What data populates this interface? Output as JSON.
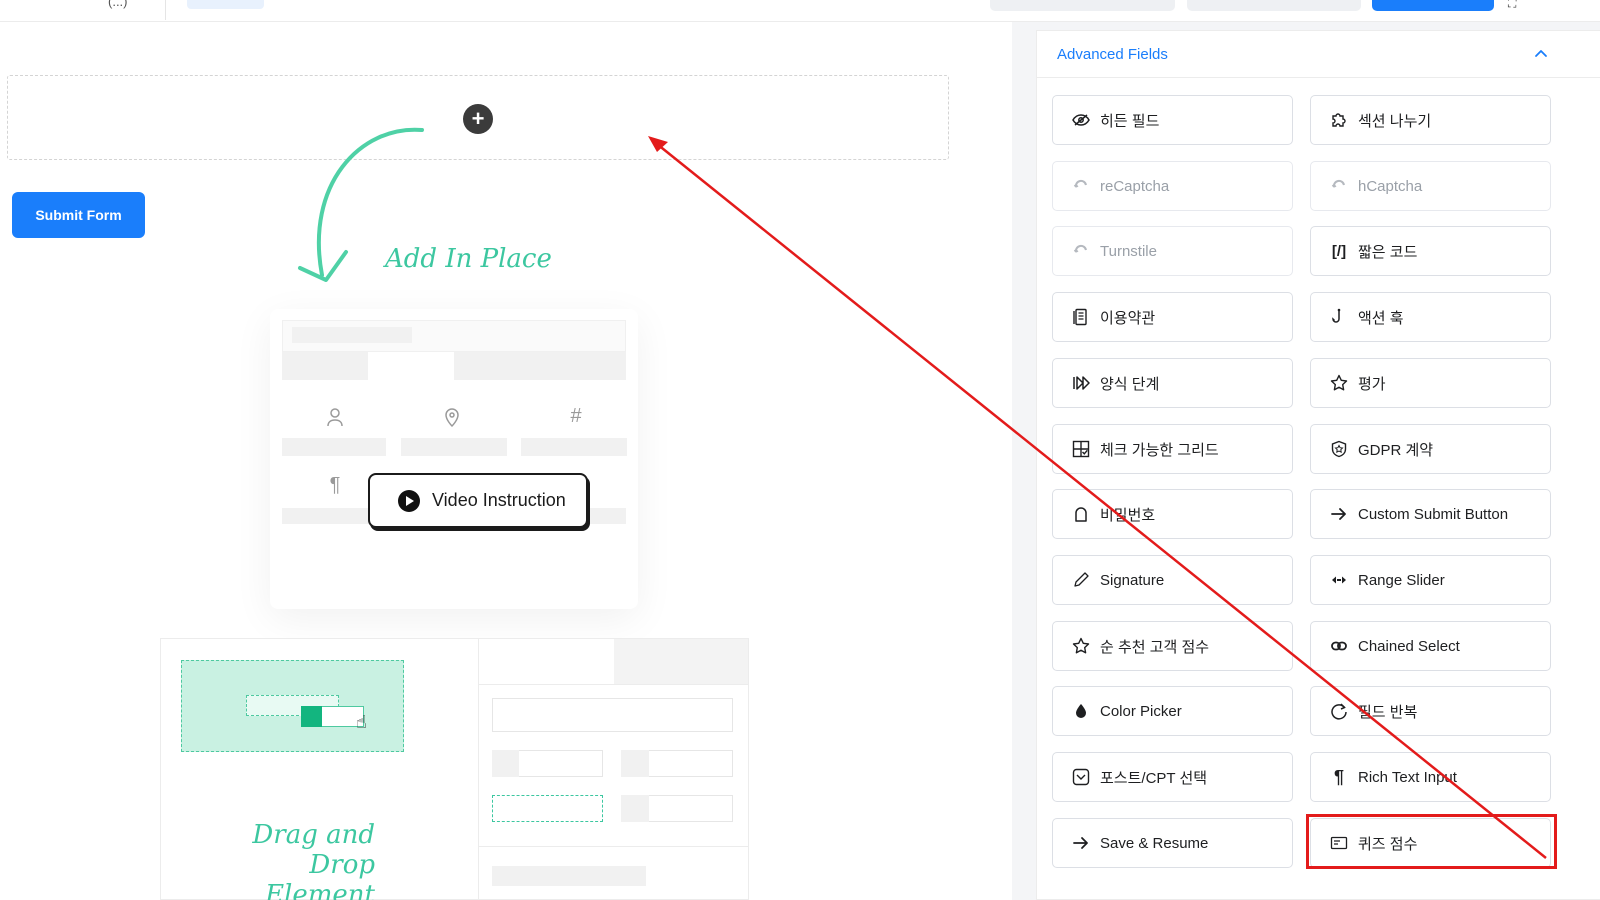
{
  "topbar": {
    "crumb": "(...)"
  },
  "canvas": {
    "submit_label": "Submit Form",
    "add_in_place": "Add In Place",
    "video_instruction": "Video Instruction",
    "drag_drop_line1": "Drag and Drop",
    "drag_drop_line2": "Element"
  },
  "panel": {
    "title": "Advanced Fields",
    "fields": [
      {
        "label": "히든 필드",
        "icon": "eye-slash-icon",
        "enabled": true
      },
      {
        "label": "섹션 나누기",
        "icon": "puzzle-icon",
        "enabled": true
      },
      {
        "label": "reCaptcha",
        "icon": "captcha-icon",
        "enabled": false
      },
      {
        "label": "hCaptcha",
        "icon": "captcha-icon",
        "enabled": false
      },
      {
        "label": "Turnstile",
        "icon": "captcha-icon",
        "enabled": false
      },
      {
        "label": "짧은 코드",
        "icon": "shortcode-icon",
        "enabled": true
      },
      {
        "label": "이용약관",
        "icon": "document-icon",
        "enabled": true
      },
      {
        "label": "액션 훅",
        "icon": "hook-icon",
        "enabled": true
      },
      {
        "label": "양식 단계",
        "icon": "steps-icon",
        "enabled": true
      },
      {
        "label": "평가",
        "icon": "star-icon",
        "enabled": true
      },
      {
        "label": "체크 가능한 그리드",
        "icon": "grid-check-icon",
        "enabled": true
      },
      {
        "label": "GDPR 계약",
        "icon": "shield-icon",
        "enabled": true
      },
      {
        "label": "비밀번호",
        "icon": "lock-icon",
        "enabled": true
      },
      {
        "label": "Custom Submit Button",
        "icon": "arrow-right-icon",
        "enabled": true
      },
      {
        "label": "Signature",
        "icon": "pen-icon",
        "enabled": true
      },
      {
        "label": "Range Slider",
        "icon": "range-icon",
        "enabled": true
      },
      {
        "label": "순 추천 고객 점수",
        "icon": "star-icon",
        "enabled": true
      },
      {
        "label": "Chained Select",
        "icon": "link-icon",
        "enabled": true
      },
      {
        "label": "Color Picker",
        "icon": "drop-icon",
        "enabled": true
      },
      {
        "label": "필드 반복",
        "icon": "repeat-icon",
        "enabled": true
      },
      {
        "label": "포스트/CPT 선택",
        "icon": "post-icon",
        "enabled": true
      },
      {
        "label": "Rich Text Input",
        "icon": "paragraph-icon",
        "enabled": true
      },
      {
        "label": "Save & Resume",
        "icon": "arrow-right-icon",
        "enabled": true
      },
      {
        "label": "퀴즈 점수",
        "icon": "quiz-icon",
        "enabled": true
      }
    ]
  },
  "annotation": {
    "highlight_color": "#e31b1b",
    "highlighted_item": "퀴즈 점수"
  }
}
